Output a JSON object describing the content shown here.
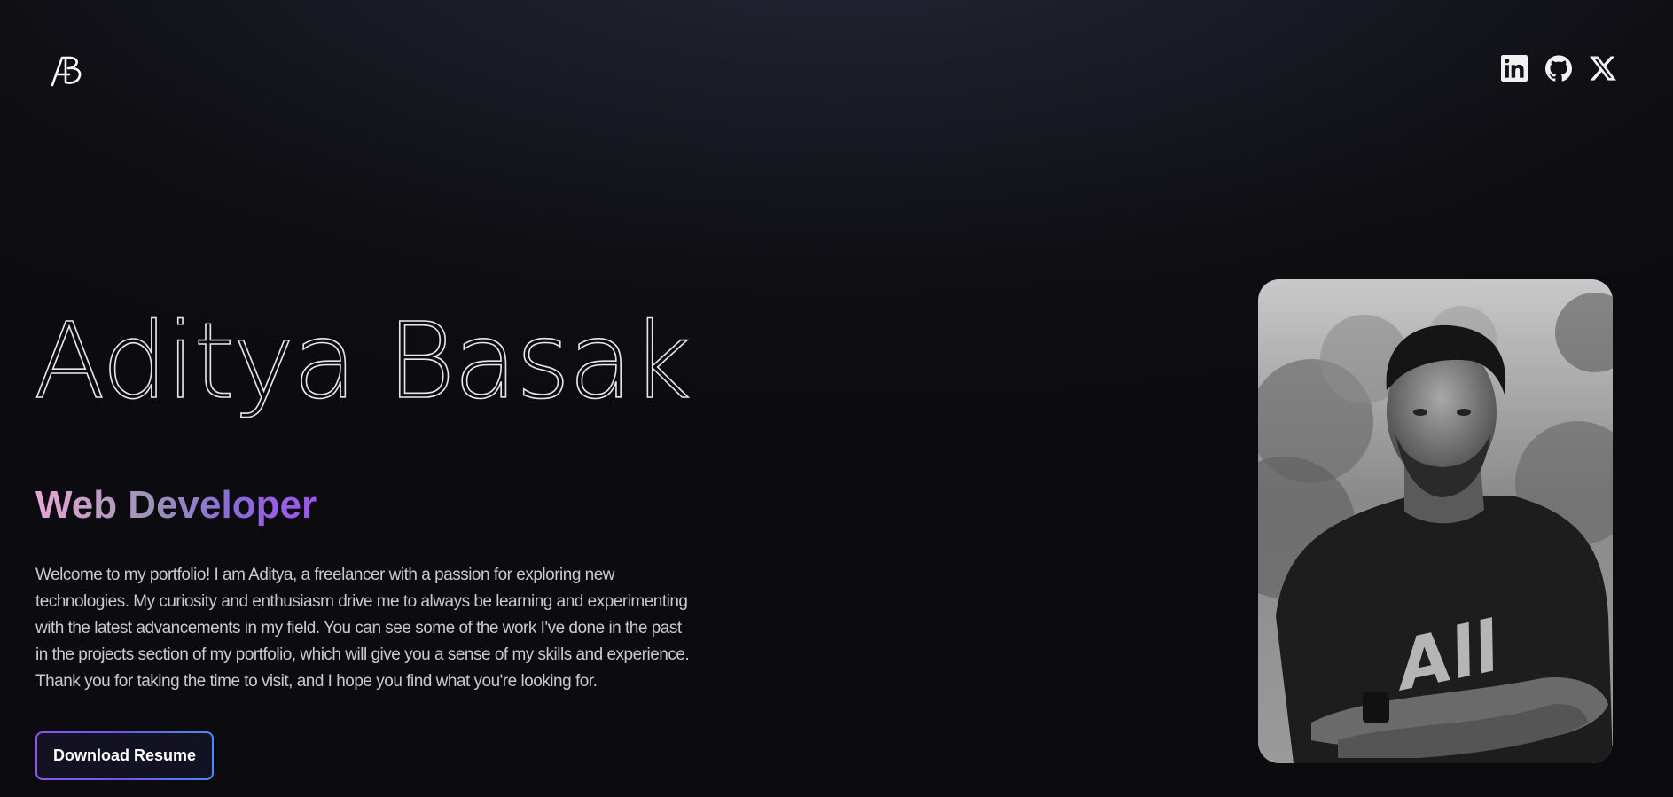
{
  "logo": {
    "icon": "ab-monogram-logo",
    "text": "AB"
  },
  "social": [
    {
      "name": "LinkedIn",
      "icon": "linkedin-icon"
    },
    {
      "name": "GitHub",
      "icon": "github-icon"
    },
    {
      "name": "X",
      "icon": "x-icon"
    }
  ],
  "hero": {
    "name": "Aditya Basak",
    "role": "Web Developer",
    "description": "Welcome to my portfolio! I am Aditya, a freelancer with a passion for exploring new technologies. My curiosity and enthusiasm drive me to always be learning and experimenting with the latest advancements in my field. You can see some of the work I've done in the past in the projects section of my portfolio, which will give you a sense of my skills and experience. Thank you for taking the time to visit, and I hope you find what you're looking for.",
    "button_label": "Download Resume"
  },
  "colors": {
    "role_gradient": [
      "#e8a7d2",
      "#9c95b8",
      "#9e57ef"
    ],
    "button_border_gradient": [
      "#8c56f2",
      "#4d8cf0"
    ],
    "background": "#0c0c10"
  }
}
